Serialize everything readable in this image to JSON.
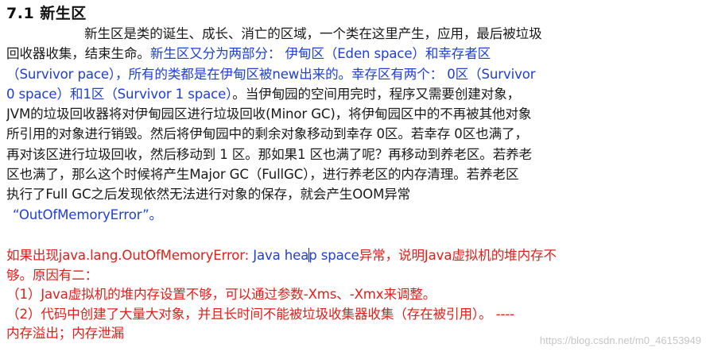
{
  "document": {
    "heading": "7.1 新生区",
    "paragraph": {
      "lines": [
        [
          {
            "text": "新生区是类的诞生、成长、消亡的区域，一个类在这里产生，应用，最后被垃圾",
            "color": "black"
          }
        ],
        [
          {
            "text": "回收器收集，结束生命。",
            "color": "black"
          },
          {
            "text": "新生区又分为两部分： 伊甸区（Eden space）和幸存者区",
            "color": "blue"
          }
        ],
        [
          {
            "text": "（Survivor pace），所有的类都是在伊甸区被new出来的。幸存区有两个： 0区（Survivor",
            "color": "blue"
          }
        ],
        [
          {
            "text": "0 space）和1区（Survivor 1 space）",
            "color": "blue"
          },
          {
            "text": "。当伊甸园的空间用完时，程序又需要创建对象，",
            "color": "black"
          }
        ],
        [
          {
            "text": "JVM的垃圾回收器将对伊甸园区进行垃圾回收(Minor GC)，将伊甸园区中的不再被其他对象",
            "color": "black"
          }
        ],
        [
          {
            "text": "所引用的对象进行销毁。然后将伊甸园中的剩余对象移动到幸存 0区。若幸存 0区也满了，",
            "color": "black"
          }
        ],
        [
          {
            "text": "再对该区进行垃圾回收，然后移动到 1 区。那如果1 区也满了呢？再移动到养老区。若养老",
            "color": "black"
          }
        ],
        [
          {
            "text": "区也满了，那么这个时候将产生Major GC（FullGC），进行养老区的内存清理。若养老区",
            "color": "black"
          }
        ],
        [
          {
            "text": "执行了Full GC之后发现依然无法进行对象的保存，就会产生OOM异常",
            "color": "black"
          }
        ],
        [
          {
            "text": "“OutOfMemoryError”。",
            "color": "blue"
          }
        ]
      ]
    },
    "oom_section": {
      "line1_part1": "如果出现java.lang.OutOfMemoryError: ",
      "line1_part2a": "Java hea",
      "line1_part2b": "p space",
      "line1_part3": "异常，说明Java虚拟机的堆内存不",
      "line2": "够。原因有二：",
      "line3": "（1）Java虚拟机的堆内存设置不够，可以通过参数-Xms、-Xmx来调整。",
      "line4": "（2）代码中创建了大量大对象，并且长时间不能被垃圾收集器收集（存在被引用）。    ----",
      "line5": "内存溢出；内存泄漏"
    },
    "watermark": "https://blog.csdn.net/m0_46153949"
  },
  "colors": {
    "black": "#1a1a1a",
    "blue": "#1f3fd6",
    "red": "#e0201a"
  }
}
